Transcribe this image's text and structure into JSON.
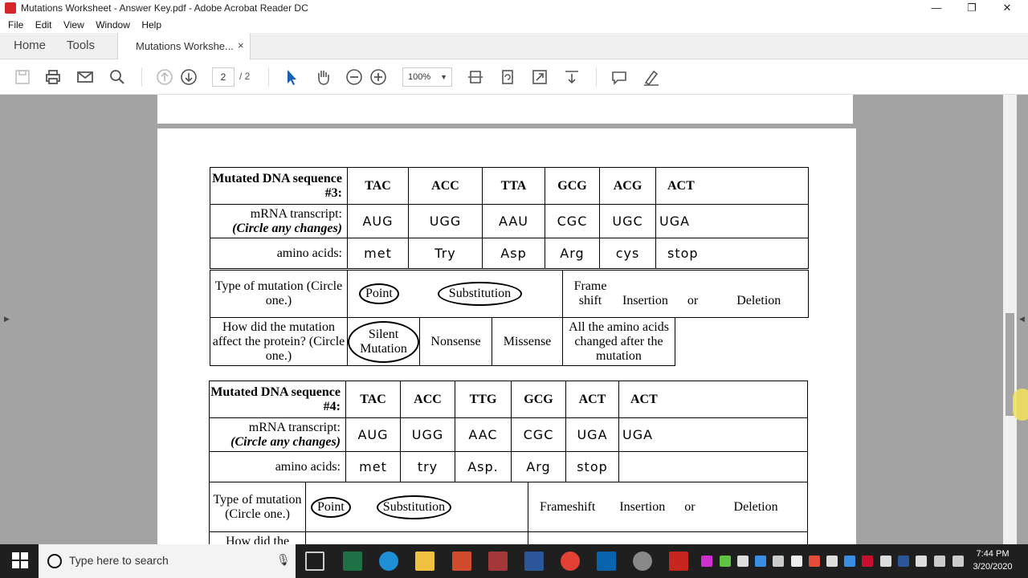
{
  "window": {
    "title": "Mutations Worksheet - Answer Key.pdf - Adobe Acrobat Reader DC",
    "minimize": "—",
    "restore": "❐",
    "close": "✕"
  },
  "menu": [
    "File",
    "Edit",
    "View",
    "Window",
    "Help"
  ],
  "tabs": {
    "home": "Home",
    "tools": "Tools",
    "document": "Mutations Workshe...",
    "close": "×"
  },
  "toolbar": {
    "page_current": "2",
    "page_total": "/ 2",
    "zoom": "100%"
  },
  "seq3": {
    "header": "Mutated DNA sequence #3:",
    "dna": [
      "TAC",
      "ACC",
      "TTA",
      "GCG",
      "ACG",
      "ACT"
    ],
    "mrna_label": "mRNA transcript:",
    "mrna_hint": "(Circle any changes)",
    "mrna": [
      "AUG",
      "UGG",
      "AAU",
      "CGC",
      "UGC",
      "UGA"
    ],
    "amino_label": "amino acids:",
    "amino": [
      "met",
      "Try",
      "Asp",
      "Arg",
      "cys",
      "stop"
    ],
    "type_label": "Type of mutation (Circle one.)",
    "point": "Point",
    "substitution": "Substitution",
    "frameshift": "Frame shift",
    "insertion": "Insertion",
    "or": "or",
    "deletion": "Deletion",
    "effect_label": "How did the mutation affect the protein? (Circle one.)",
    "silent": "Silent Mutation",
    "nonsense": "Nonsense",
    "missense": "Missense",
    "all_changed": "All the amino acids changed after the mutation"
  },
  "seq4": {
    "header": "Mutated DNA sequence #4:",
    "dna": [
      "TAC",
      "ACC",
      "TTG",
      "GCG",
      "ACT",
      "ACT"
    ],
    "mrna_label": "mRNA transcript:",
    "mrna_hint": "(Circle any changes)",
    "mrna": [
      "AUG",
      "UGG",
      "AAC",
      "CGC",
      "UGA",
      "UGA"
    ],
    "amino_label": "amino acids:",
    "amino": [
      "met",
      "try",
      "Asp.",
      "Arg",
      "stop",
      ""
    ],
    "type_label": "Type of mutation (Circle one.)",
    "point": "Point",
    "substitution": "Substitution",
    "frameshift": "Frameshift",
    "insertion": "Insertion",
    "or": "or",
    "deletion": "Deletion",
    "effect_label": "How did the"
  },
  "taskbar": {
    "search_placeholder": "Type here to search",
    "time": "7:44 PM",
    "date": "3/20/2020"
  }
}
